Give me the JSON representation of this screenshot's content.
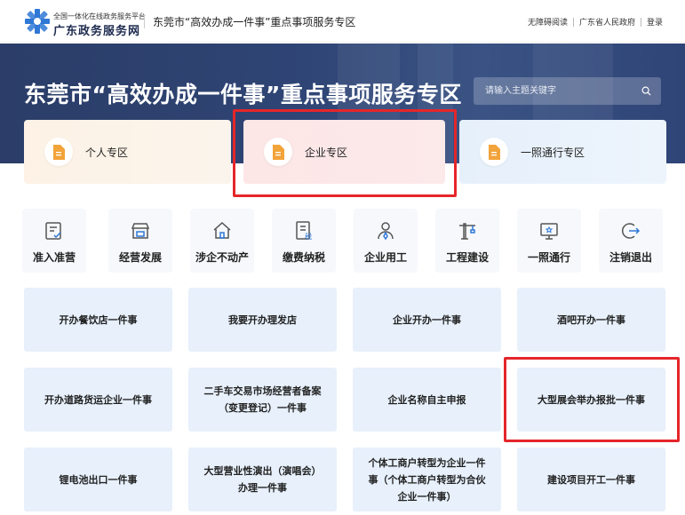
{
  "header": {
    "brand_small": "全国一体化在线政务服务平台",
    "brand_big": "广东政务服务网",
    "page_title": "东莞市“高效办成一件事”重点事项服务专区",
    "links": [
      "无障碍阅读",
      "广东省人民政府",
      "登录"
    ]
  },
  "banner": {
    "title": "东莞市“高效办成一件事”重点事项服务专区",
    "search_placeholder": "请输入主题关键字"
  },
  "zones": [
    {
      "label": "个人专区"
    },
    {
      "label": "企业专区"
    },
    {
      "label": "一照通行专区"
    }
  ],
  "categories": [
    {
      "label": "准入准营",
      "icon": "checklist-icon"
    },
    {
      "label": "经营发展",
      "icon": "shop-icon"
    },
    {
      "label": "涉企不动产",
      "icon": "house-icon"
    },
    {
      "label": "缴费纳税",
      "icon": "tax-document-icon"
    },
    {
      "label": "企业用工",
      "icon": "worker-icon"
    },
    {
      "label": "工程建设",
      "icon": "crane-icon"
    },
    {
      "label": "一照通行",
      "icon": "license-monitor-icon"
    },
    {
      "label": "注销退出",
      "icon": "exit-icon"
    }
  ],
  "tiles": [
    [
      "开办餐饮店一件事"
    ],
    [
      "我要开办理发店"
    ],
    [
      "企业开办一件事"
    ],
    [
      "酒吧开办一件事"
    ],
    [
      "开办道路货运企业一件事"
    ],
    [
      "二手车交易市场经营者备案",
      "（变更登记）一件事"
    ],
    [
      "企业名称自主申报"
    ],
    [
      "大型展会举办报批一件事"
    ],
    [
      "锂电池出口一件事"
    ],
    [
      "大型营业性演出（演唱会）",
      "办理一件事"
    ],
    [
      "个体工商户转型为企业一件",
      "事（个体工商户转型为合伙",
      "企业一件事）"
    ],
    [
      "建设项目开工一件事"
    ]
  ],
  "colors": {
    "highlight": "#e5262a",
    "banner": "#2f4575",
    "tile": "#e7f0fb",
    "brand": "#3a7bd5"
  }
}
